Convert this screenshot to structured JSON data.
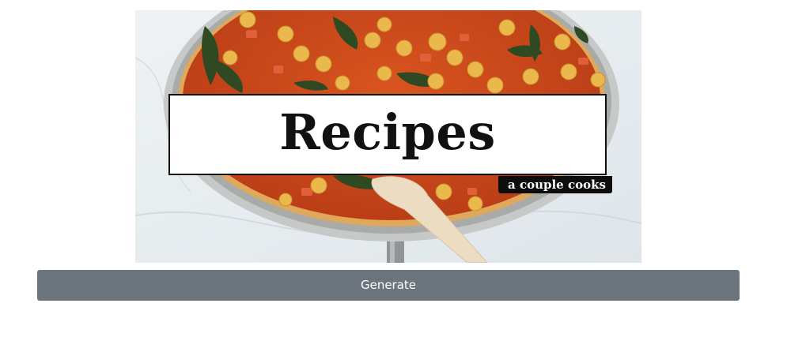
{
  "hero": {
    "title": "Recipes",
    "brand": "a couple cooks",
    "image_subject": "chickpea-spinach-stew-pan"
  },
  "actions": {
    "generate_label": "Generate"
  },
  "colors": {
    "button_bg": "#6c757d",
    "button_text": "#ffffff",
    "card_bg": "#ffffff",
    "card_border": "#111111",
    "brand_tag_bg": "#0d0d0d",
    "sauce": "#cc4a1e",
    "chickpea": "#e9b64a"
  }
}
